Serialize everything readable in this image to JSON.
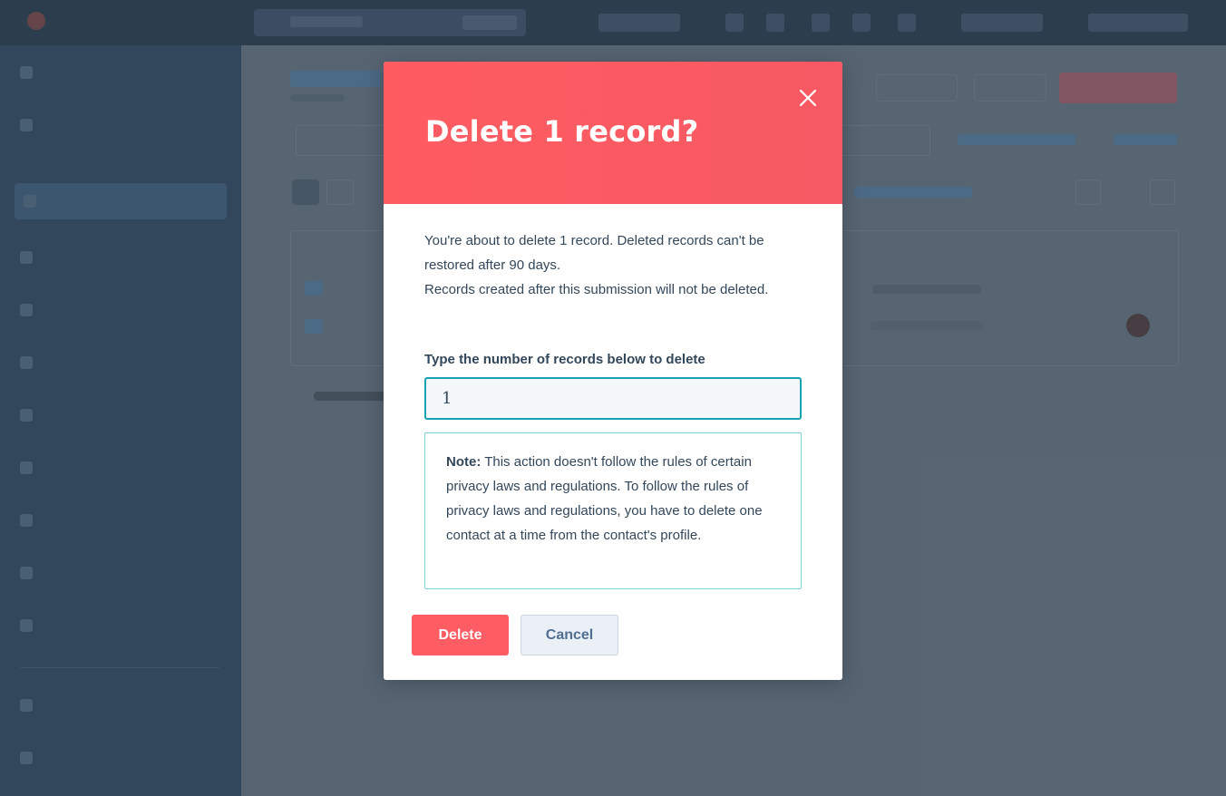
{
  "modal": {
    "title": "Delete 1 record?",
    "close_icon": "close-icon",
    "description_line1": "You're about to delete 1 record. Deleted records can't be restored after 90 days.",
    "description_line2": "Records created after this submission will not be deleted.",
    "input_label": "Type the number of records below to delete",
    "input_value": "1",
    "note_label": "Note:",
    "note_text": " This action doesn't follow the rules of certain privacy laws and regulations. To follow the rules of privacy laws and regulations, you have to delete one contact at a time from the contact's profile.",
    "delete_label": "Delete",
    "cancel_label": "Cancel"
  },
  "colors": {
    "header": "#ff5c62",
    "delete_button": "#ff5c64",
    "input_border": "#17a2b2",
    "note_border": "#7fd1de",
    "text": "#33475b"
  }
}
